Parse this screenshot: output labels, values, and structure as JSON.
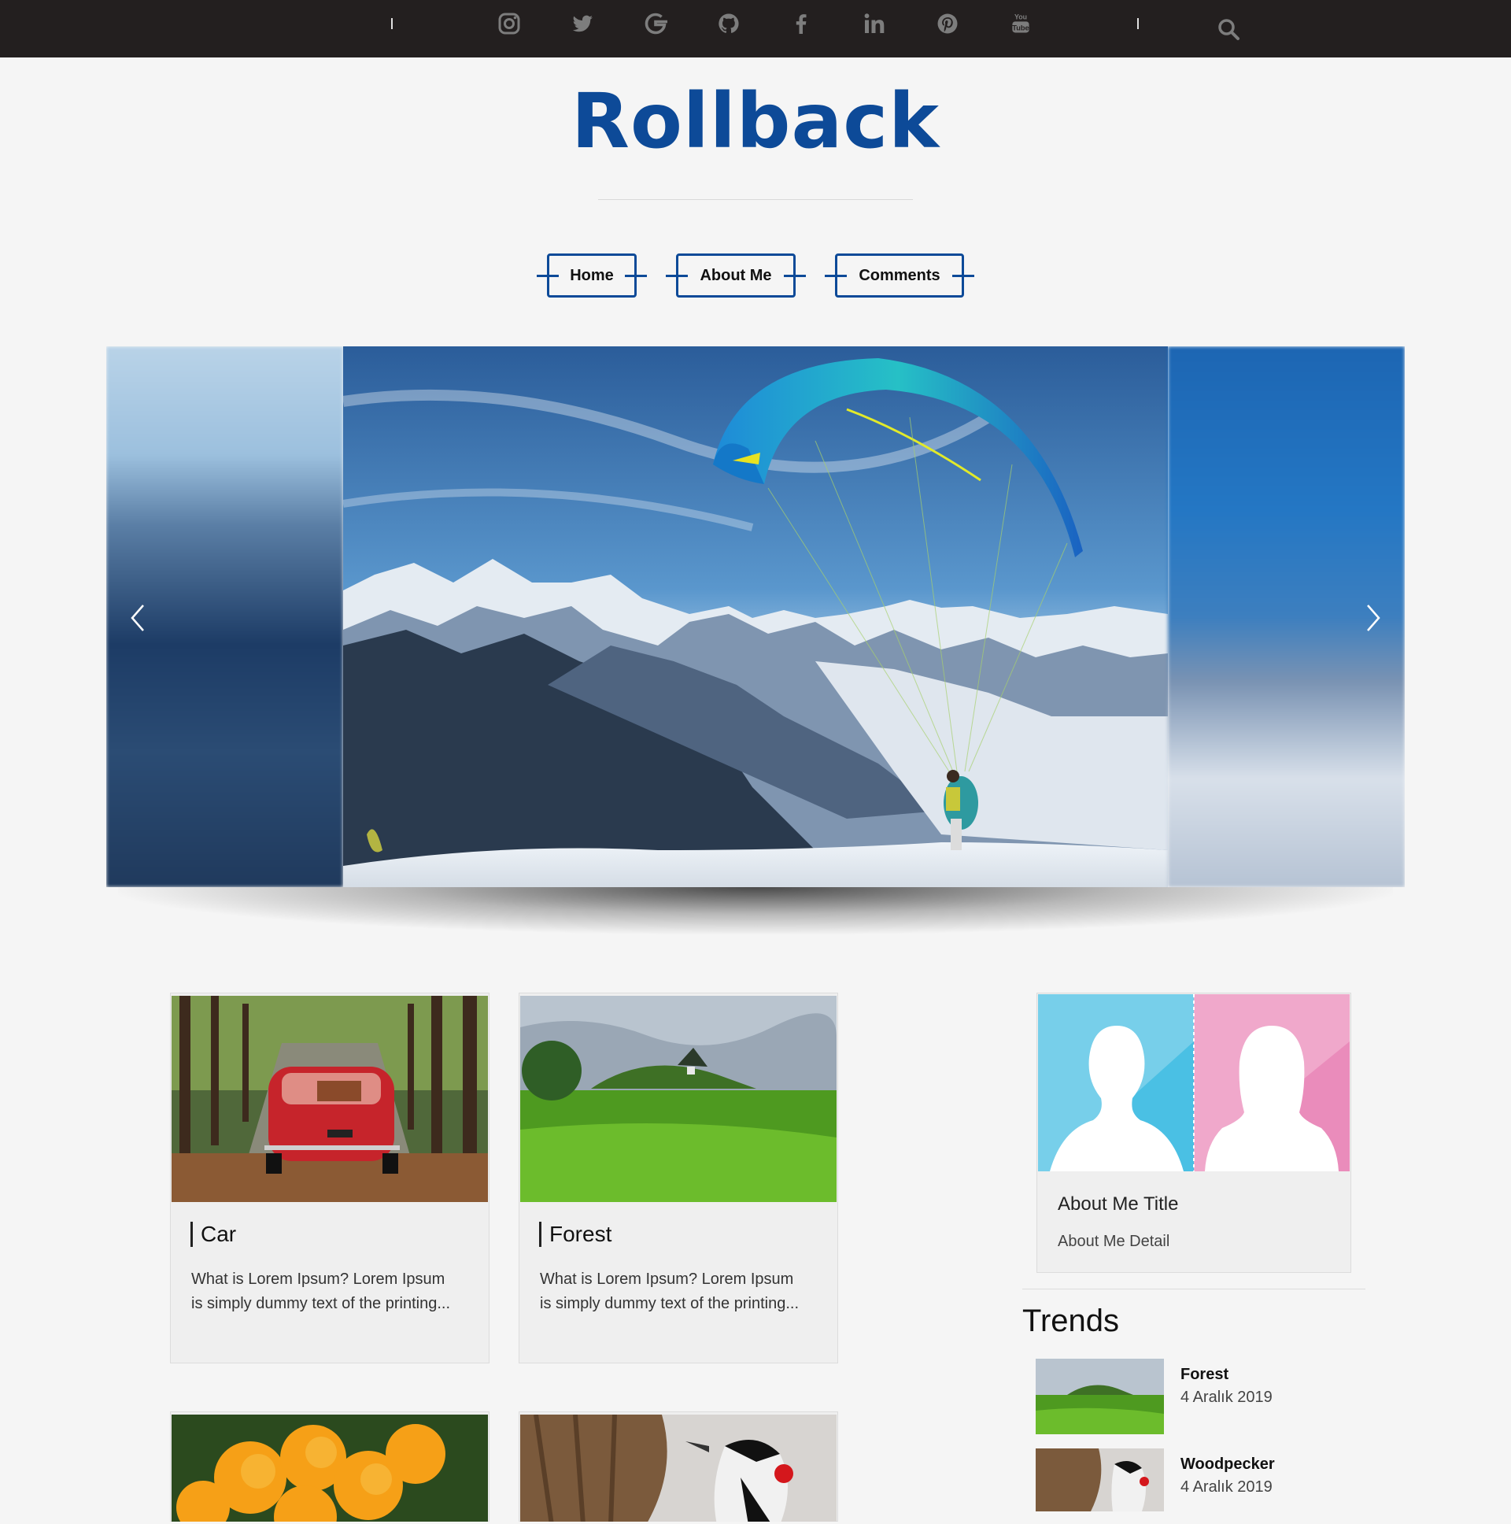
{
  "topbar": {
    "social": [
      {
        "name": "instagram-icon"
      },
      {
        "name": "twitter-icon"
      },
      {
        "name": "google-icon"
      },
      {
        "name": "github-icon"
      },
      {
        "name": "facebook-icon"
      },
      {
        "name": "linkedin-icon"
      },
      {
        "name": "pinterest-icon"
      },
      {
        "name": "youtube-icon",
        "label_top": "You",
        "label_bottom": "Tube"
      }
    ],
    "search_icon": "search-icon"
  },
  "brand": {
    "title": "Rollback",
    "color": "#0d4a98"
  },
  "nav": {
    "items": [
      {
        "label": "Home"
      },
      {
        "label": "About Me"
      },
      {
        "label": "Comments"
      }
    ]
  },
  "slider": {
    "prev_icon": "chevron-left-icon",
    "next_icon": "chevron-right-icon"
  },
  "posts": [
    {
      "title": "Car",
      "excerpt": "What is Lorem Ipsum? Lorem Ipsum is simply dummy text of the printing..."
    },
    {
      "title": "Forest",
      "excerpt": "What is Lorem Ipsum? Lorem Ipsum is simply dummy text of the printing..."
    }
  ],
  "sidebar": {
    "about": {
      "title": "About Me Title",
      "detail": "About Me Detail"
    },
    "trends_heading": "Trends",
    "trends": [
      {
        "title": "Forest",
        "date": "4 Aralık 2019"
      },
      {
        "title": "Woodpecker",
        "date": "4 Aralık 2019"
      }
    ]
  }
}
